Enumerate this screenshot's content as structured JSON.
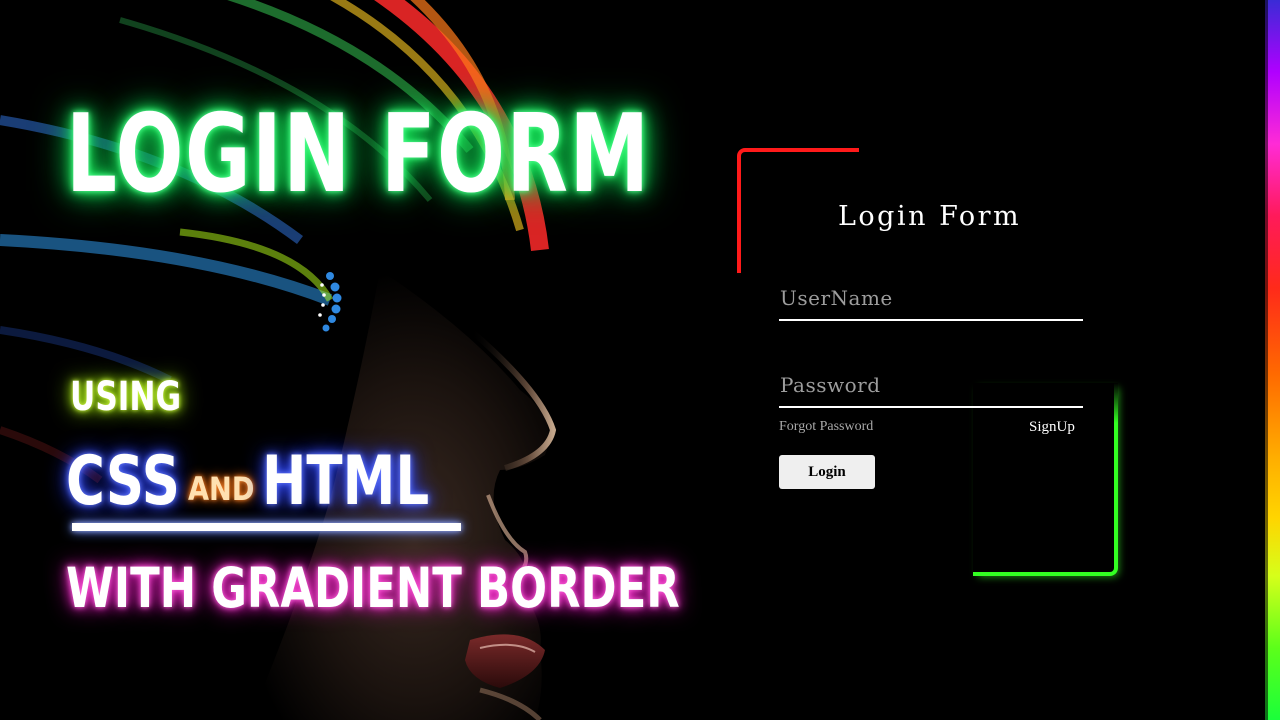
{
  "hero": {
    "title": "LOGIN FORM",
    "line_using": "USING",
    "line_css": "CSS",
    "line_and": "AND",
    "line_html": "HTML",
    "line_with": "WITH GRADIENT BORDER"
  },
  "login_form": {
    "title": "Login Form",
    "username_placeholder": "UserName",
    "username_value": "",
    "password_placeholder": "Password",
    "password_value": "",
    "forgot_password_label": "Forgot Password",
    "signup_label": "SignUp",
    "login_button_label": "Login"
  },
  "colors": {
    "title_glow": "#22ff66",
    "using_glow": "#b8ff1a",
    "css_html_glow": "#3d5bff",
    "and_glow": "#ff6a00",
    "gradient_line_glow": "#ff2bd0",
    "border_corner_red": "#ff1a1a",
    "border_corner_green": "#33ff22",
    "login_button_bg": "#efefef",
    "page_background": "#000000"
  }
}
